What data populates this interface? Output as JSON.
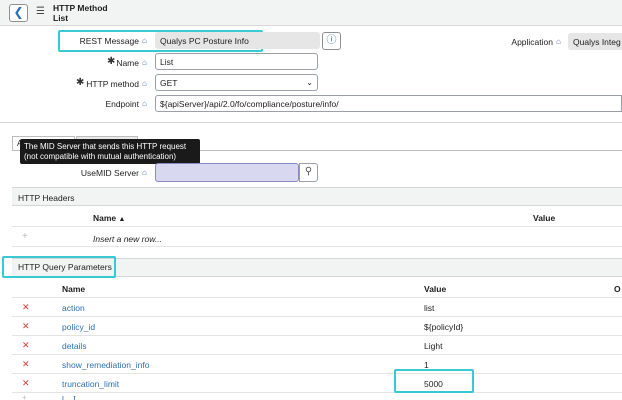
{
  "header": {
    "record_type": "HTTP Method",
    "record_name": "List",
    "back_icon": "chevron-left-icon",
    "menu_icon": "hamburger-icon"
  },
  "form": {
    "rest_message": {
      "label": "REST Message",
      "value": "Qualys PC Posture Info"
    },
    "application": {
      "label": "Application",
      "value": "Qualys Integra"
    },
    "name": {
      "label": "Name",
      "value": "List"
    },
    "http_method": {
      "label": "HTTP method",
      "value": "GET"
    },
    "endpoint": {
      "label": "Endpoint",
      "value": "${apiServer}/api/2.0/fo/compliance/posture/info/"
    },
    "mid_server": {
      "label": "MID Server",
      "label_prefix": "Use",
      "value": ""
    }
  },
  "tooltip": {
    "line1": "The MID Server that sends this HTTP request",
    "line2": "(not compatible with mutual authentication)"
  },
  "tabs": [
    {
      "label": "A"
    },
    {
      "label": ""
    }
  ],
  "http_headers": {
    "title": "HTTP Headers",
    "columns": {
      "name": "Name",
      "value": "Value"
    },
    "sort_indicator": "▲",
    "insert_row": "Insert a new row...",
    "add_icon": "plus-icon"
  },
  "query_params": {
    "title": "HTTP Query Parameters",
    "columns": {
      "name": "Name",
      "value": "Value",
      "extra": "O"
    },
    "rows": [
      {
        "name": "action",
        "value": "list"
      },
      {
        "name": "policy_id",
        "value": "${policyId}"
      },
      {
        "name": "details",
        "value": "Light"
      },
      {
        "name": "show_remediation_info",
        "value": "1"
      },
      {
        "name": "truncation_limit",
        "value": "5000"
      }
    ],
    "partial_row": "l... t"
  },
  "colors": {
    "highlight": "#39c9d3",
    "link": "#2d6fb1",
    "delete": "#d13d3d",
    "mid_field_bg": "#d8d8f0"
  }
}
